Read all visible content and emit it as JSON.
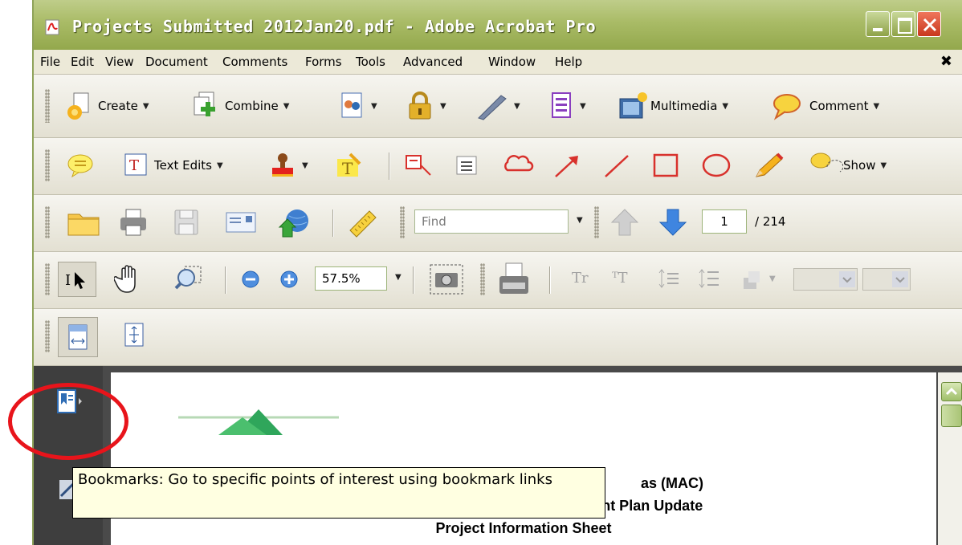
{
  "window": {
    "title": "Projects Submitted 2012Jan20.pdf - Adobe Acrobat Pro",
    "controls": {
      "minimize": "minimize-button",
      "maximize": "maximize-button",
      "close": "close-button"
    }
  },
  "menu": {
    "items": [
      "File",
      "Edit",
      "View",
      "Document",
      "Comments",
      "Forms",
      "Tools",
      "Advanced",
      "Window",
      "Help"
    ],
    "close_glyph": "✖"
  },
  "toolbar1": {
    "create": "Create",
    "combine": "Combine",
    "multimedia": "Multimedia",
    "comment": "Comment"
  },
  "toolbar2": {
    "text_edits": "Text Edits",
    "show": "Show"
  },
  "toolbar3": {
    "find_placeholder": "Find",
    "page_current": "1",
    "page_total": "/ 214"
  },
  "toolbar4": {
    "zoom": "57.5%",
    "text_tool_1": "Tr",
    "text_tool_2": "ᵀT"
  },
  "document": {
    "line1": "as (MAC)",
    "line2": "Integrated Regional Water Management Plan Update",
    "line3": "Project Information Sheet"
  },
  "tooltip": {
    "text": "Bookmarks: Go to specific points of interest using bookmark links"
  },
  "colors": {
    "titlebar": "#a9bb66",
    "annotation": "#e8141b",
    "tooltip_bg": "#ffffe1"
  }
}
